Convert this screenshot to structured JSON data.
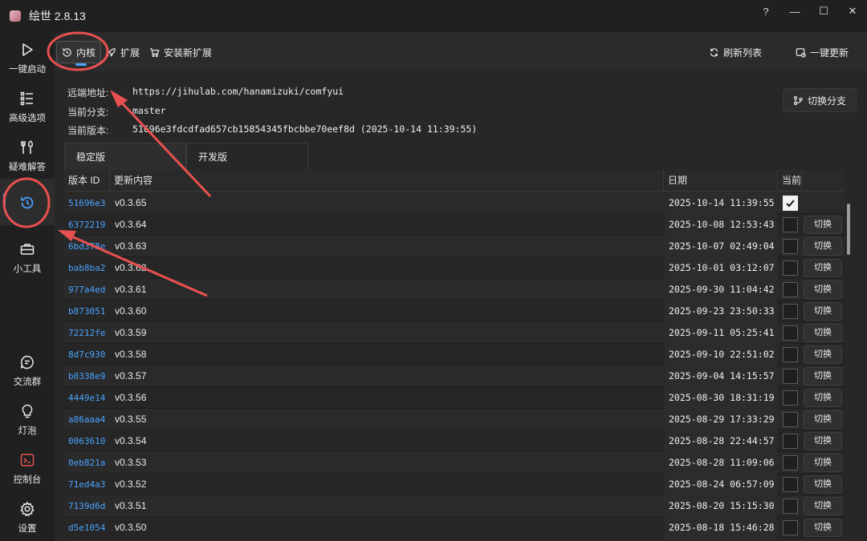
{
  "window": {
    "title": "绘世 2.8.13",
    "controls": [
      "?",
      "—",
      "☐",
      "✕"
    ]
  },
  "sidebar": {
    "items": [
      {
        "label": "一键启动",
        "icon": "play-icon"
      },
      {
        "label": "高级选项",
        "icon": "list-settings-icon"
      },
      {
        "label": "疑难解答",
        "icon": "tools-icon"
      },
      {
        "label": "",
        "icon": "history-icon",
        "active": true
      },
      {
        "label": "小工具",
        "icon": "toolbox-icon"
      },
      {
        "label": "交流群",
        "icon": "chat-icon"
      },
      {
        "label": "灯泡",
        "icon": "lightbulb-icon"
      },
      {
        "label": "控制台",
        "icon": "console-icon"
      },
      {
        "label": "设置",
        "icon": "gear-icon"
      }
    ]
  },
  "toolbar": {
    "kernel": "内核",
    "extensions": "扩展",
    "install_extension": "安装新扩展",
    "refresh_list": "刷新列表",
    "one_click_update": "一键更新"
  },
  "info": {
    "remote_label": "远端地址:",
    "remote_value": "https://jihulab.com/hanamizuki/comfyui",
    "branch_label": "当前分支:",
    "branch_value": "master",
    "version_label": "当前版本:",
    "version_value": "51696e3fdcdfad657cb15854345fbcbbe70eef8d (2025-10-14 11:39:55)",
    "switch_branch": "切换分支"
  },
  "tabs": [
    "稳定版",
    "开发版"
  ],
  "table": {
    "headers": {
      "id": "版本 ID",
      "content": "更新内容",
      "date": "日期",
      "current": "当前",
      "action": ""
    },
    "switch_label": "切换",
    "rows": [
      {
        "id": "51696e3",
        "content": "v0.3.65",
        "date": "2025-10-14 11:39:55",
        "current": true
      },
      {
        "id": "6372219",
        "content": "v0.3.64",
        "date": "2025-10-08 12:53:43",
        "current": false
      },
      {
        "id": "6bd378e",
        "content": "v0.3.63",
        "date": "2025-10-07 02:49:04",
        "current": false
      },
      {
        "id": "bab8ba2",
        "content": "v0.3.62",
        "date": "2025-10-01 03:12:07",
        "current": false
      },
      {
        "id": "977a4ed",
        "content": "v0.3.61",
        "date": "2025-09-30 11:04:42",
        "current": false
      },
      {
        "id": "b873051",
        "content": "v0.3.60",
        "date": "2025-09-23 23:50:33",
        "current": false
      },
      {
        "id": "72212fe",
        "content": "v0.3.59",
        "date": "2025-09-11 05:25:41",
        "current": false
      },
      {
        "id": "8d7c930",
        "content": "v0.3.58",
        "date": "2025-09-10 22:51:02",
        "current": false
      },
      {
        "id": "b0338e9",
        "content": "v0.3.57",
        "date": "2025-09-04 14:15:57",
        "current": false
      },
      {
        "id": "4449e14",
        "content": "v0.3.56",
        "date": "2025-08-30 18:31:19",
        "current": false
      },
      {
        "id": "a86aaa4",
        "content": "v0.3.55",
        "date": "2025-08-29 17:33:29",
        "current": false
      },
      {
        "id": "0063610",
        "content": "v0.3.54",
        "date": "2025-08-28 22:44:57",
        "current": false
      },
      {
        "id": "0eb821a",
        "content": "v0.3.53",
        "date": "2025-08-28 11:09:06",
        "current": false
      },
      {
        "id": "71ed4a3",
        "content": "v0.3.52",
        "date": "2025-08-24 06:57:09",
        "current": false
      },
      {
        "id": "7139d6d",
        "content": "v0.3.51",
        "date": "2025-08-20 15:15:30",
        "current": false
      },
      {
        "id": "d5e1054",
        "content": "v0.3.50",
        "date": "2025-08-18 15:46:28",
        "current": false
      }
    ]
  },
  "colors": {
    "accent": "#4aa3ff",
    "annotation": "#e8514f"
  }
}
